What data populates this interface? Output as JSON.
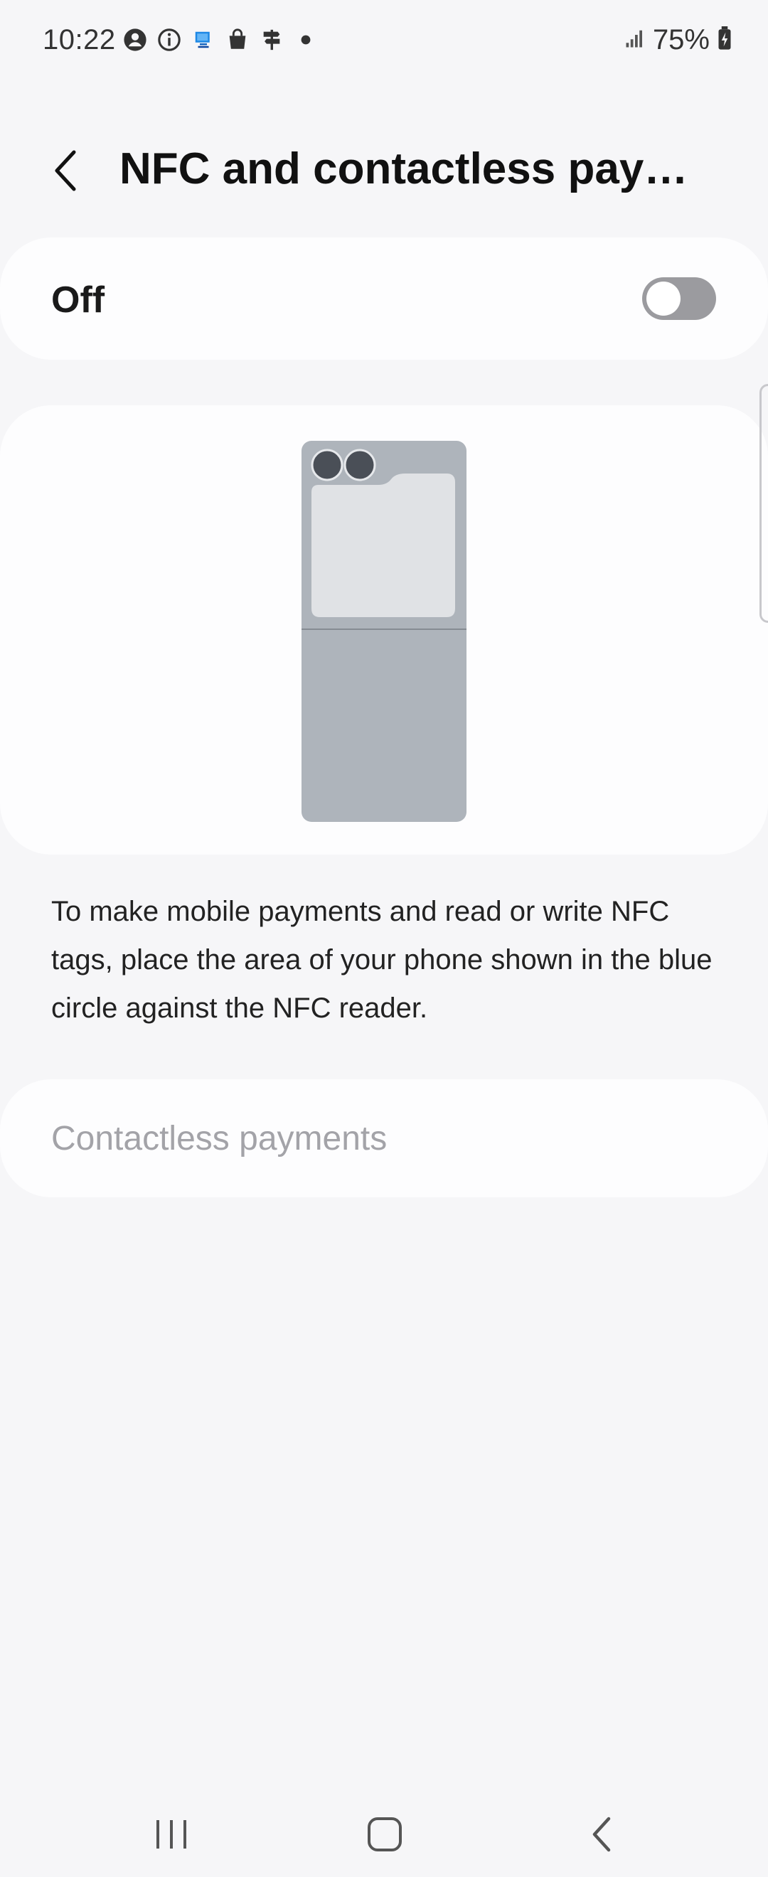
{
  "status_bar": {
    "time": "10:22",
    "battery": "75%",
    "left_icons": [
      "account-circle-icon",
      "info-icon",
      "monitor-icon",
      "shopping-bag-icon",
      "signpost-icon",
      "dot-icon"
    ],
    "right_icons": [
      "signal-icon",
      "battery-charging-icon"
    ]
  },
  "header": {
    "title": "NFC and contactless paym...",
    "back_icon": "chevron-left-icon"
  },
  "toggle": {
    "label": "Off",
    "state": "off"
  },
  "illustration": {
    "icon": "flip-phone-illustration"
  },
  "description": "To make mobile payments and read or write NFC tags, place the area of your phone shown in the blue circle against the NFC reader.",
  "contactless_payments": {
    "label": "Contactless payments",
    "enabled": false
  },
  "nav_bar": {
    "recents_icon": "recents-icon",
    "home_icon": "home-icon",
    "back_icon": "back-icon"
  },
  "colors": {
    "background": "#f6f6f8",
    "card": "#fdfdfe",
    "toggle_off": "#9b9b9f",
    "disabled_text": "#a3a3a8",
    "phone_body": "#aeb4bb",
    "phone_screen": "#e0e2e5",
    "camera": "#4a4f57"
  }
}
